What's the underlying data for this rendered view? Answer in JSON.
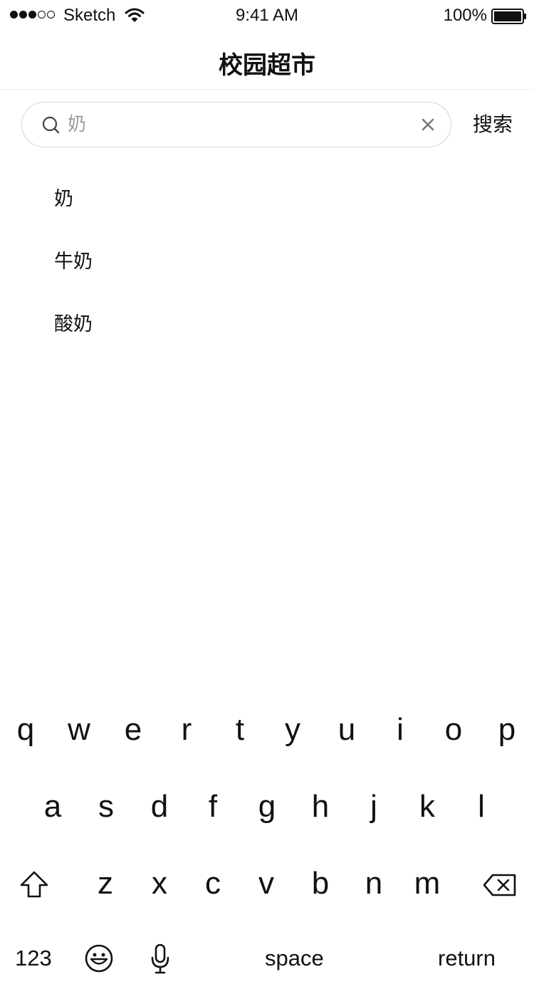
{
  "status_bar": {
    "carrier": "Sketch",
    "time": "9:41 AM",
    "battery": "100%",
    "signal_icon": "signal-dots-icon",
    "wifi_icon": "wifi-icon",
    "battery_icon": "battery-icon"
  },
  "nav": {
    "title": "校园超市"
  },
  "search": {
    "value": "奶",
    "search_icon": "search-icon",
    "clear_icon": "clear-icon",
    "button_label": "搜索"
  },
  "suggestions": [
    "奶",
    "牛奶",
    "酸奶"
  ],
  "keyboard": {
    "row1": [
      "q",
      "w",
      "e",
      "r",
      "t",
      "y",
      "u",
      "i",
      "o",
      "p"
    ],
    "row2": [
      "a",
      "s",
      "d",
      "f",
      "g",
      "h",
      "j",
      "k",
      "l"
    ],
    "row3": [
      "z",
      "x",
      "c",
      "v",
      "b",
      "n",
      "m"
    ],
    "numbers_label": "123",
    "space_label": "space",
    "return_label": "return",
    "shift_icon": "shift-icon",
    "delete_icon": "delete-icon",
    "emoji_icon": "emoji-icon",
    "mic_icon": "microphone-icon"
  },
  "colors": {
    "text": "#111111",
    "placeholder_text": "#9b9b9b",
    "border": "#d6d6d6",
    "divider": "#ececec"
  }
}
